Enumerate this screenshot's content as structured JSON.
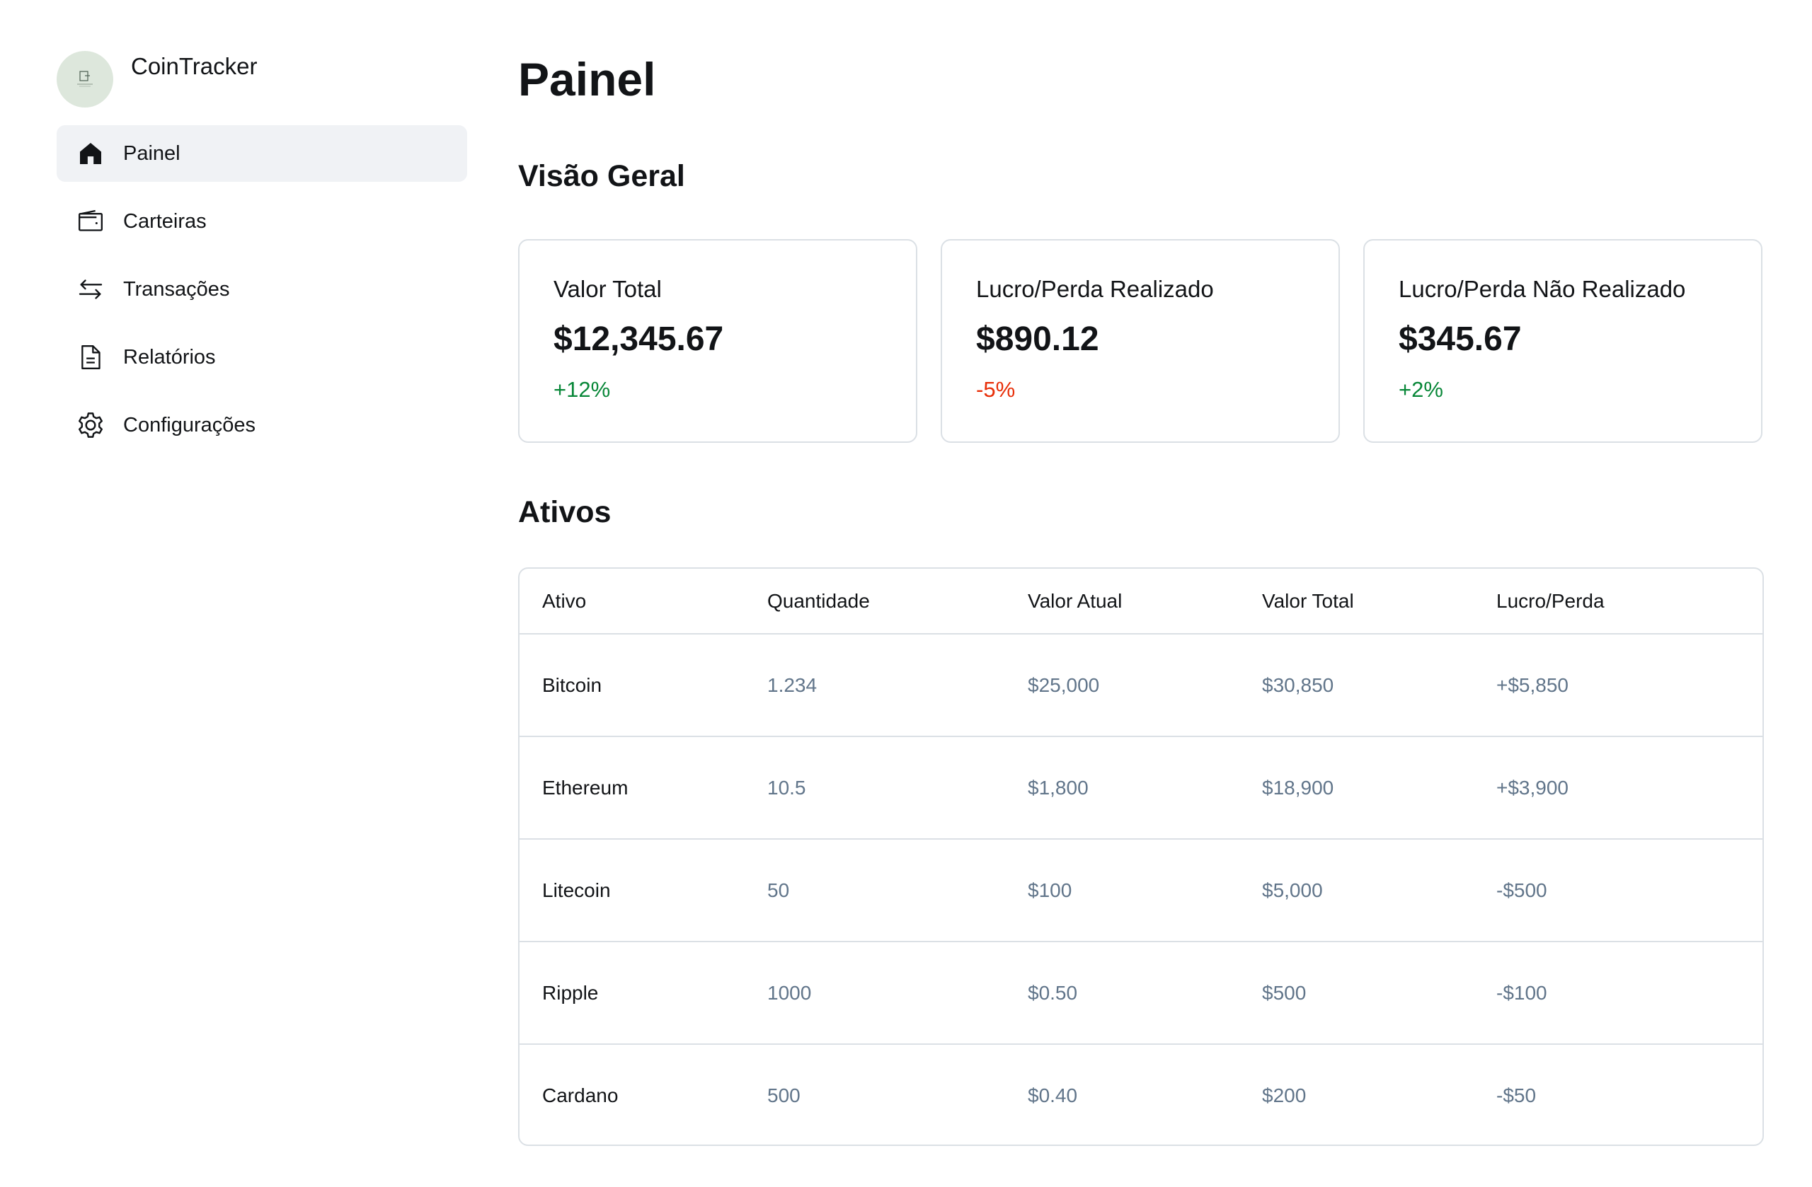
{
  "app": {
    "name": "CoinTracker"
  },
  "sidebar": {
    "items": [
      {
        "label": "Painel",
        "icon": "home-icon",
        "active": true
      },
      {
        "label": "Carteiras",
        "icon": "wallet-icon",
        "active": false
      },
      {
        "label": "Transações",
        "icon": "transfer-arrows-icon",
        "active": false
      },
      {
        "label": "Relatórios",
        "icon": "document-icon",
        "active": false
      },
      {
        "label": "Configurações",
        "icon": "gear-icon",
        "active": false
      }
    ]
  },
  "page": {
    "title": "Painel"
  },
  "overview": {
    "title": "Visão Geral",
    "cards": [
      {
        "label": "Valor Total",
        "value": "$12,345.67",
        "change": "+12%",
        "trend": "positive"
      },
      {
        "label": "Lucro/Perda Realizado",
        "value": "$890.12",
        "change": "-5%",
        "trend": "negative"
      },
      {
        "label": "Lucro/Perda Não Realizado",
        "value": "$345.67",
        "change": "+2%",
        "trend": "positive"
      }
    ]
  },
  "assets": {
    "title": "Ativos",
    "columns": [
      "Ativo",
      "Quantidade",
      "Valor Atual",
      "Valor Total",
      "Lucro/Perda"
    ],
    "rows": [
      [
        "Bitcoin",
        "1.234",
        "$25,000",
        "$30,850",
        "+$5,850"
      ],
      [
        "Ethereum",
        "10.5",
        "$1,800",
        "$18,900",
        "+$3,900"
      ],
      [
        "Litecoin",
        "50",
        "$100",
        "$5,000",
        "-$500"
      ],
      [
        "Ripple",
        "1000",
        "$0.50",
        "$500",
        "-$100"
      ],
      [
        "Cardano",
        "500",
        "$0.40",
        "$200",
        "-$50"
      ]
    ]
  },
  "colors": {
    "positive": "#088738",
    "negative": "#e82e08",
    "muted": "#61758a",
    "border": "#dbe0e5",
    "active_bg": "#f0f2f5"
  }
}
